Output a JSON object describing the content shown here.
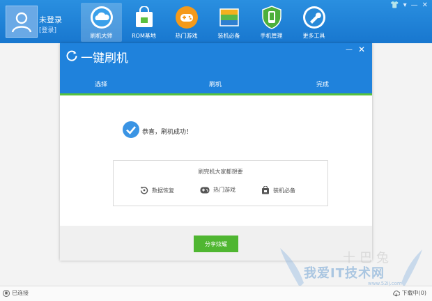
{
  "user": {
    "name": "未登录",
    "login": "[登录]"
  },
  "nav": [
    {
      "label": "刷机大师",
      "icon": "cloud-icon",
      "active": true
    },
    {
      "label": "ROM基地",
      "icon": "shopping-bag-icon",
      "active": false
    },
    {
      "label": "热门游戏",
      "icon": "gamepad-icon",
      "active": false
    },
    {
      "label": "装机必备",
      "icon": "stack-icon",
      "active": false
    },
    {
      "label": "手机管理",
      "icon": "phone-shield-icon",
      "active": false
    },
    {
      "label": "更多工具",
      "icon": "wrench-icon",
      "active": false
    }
  ],
  "dialog": {
    "title": "一键刷机",
    "steps": [
      "选择",
      "刷机",
      "完成"
    ],
    "success": "恭喜，刷机成功！",
    "recommend": {
      "title": "刷完机大家都想要",
      "items": [
        {
          "label": "数据恢复",
          "icon": "restore-icon"
        },
        {
          "label": "热门游戏",
          "icon": "gamepad-icon"
        },
        {
          "label": "装机必备",
          "icon": "bag-icon"
        }
      ]
    },
    "share_button": "分享炫耀"
  },
  "status": {
    "connection": "已连接",
    "downloads": "下载中(0)"
  },
  "watermark": {
    "top": "十巴兔",
    "main": "我爱IT技术网",
    "url": "www.52ij.com"
  },
  "colors": {
    "accent": "#1f82dc",
    "progress": "#56c23d",
    "button": "#4fb631"
  }
}
